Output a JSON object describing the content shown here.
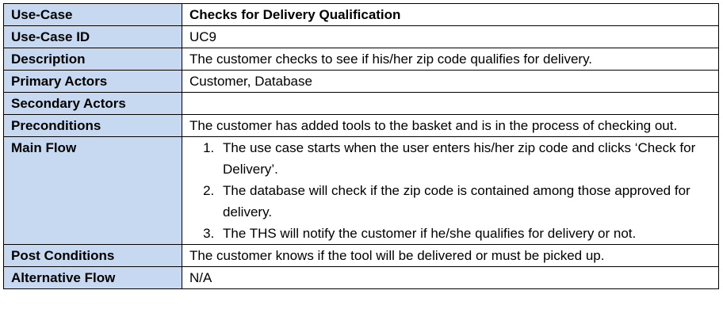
{
  "rows": [
    {
      "label": "Use-Case",
      "value": "Checks for Delivery Qualification"
    },
    {
      "label": "Use-Case ID",
      "value": "UC9"
    },
    {
      "label": "Description",
      "value": "The customer checks to see if his/her zip code qualifies for delivery."
    },
    {
      "label": "Primary Actors",
      "value": "Customer, Database"
    },
    {
      "label": "Secondary Actors",
      "value": ""
    },
    {
      "label": "Preconditions",
      "value": "The customer has added tools to the basket and is in the process of checking out."
    },
    {
      "label": "Main Flow",
      "steps": [
        "The use case starts when the user enters his/her zip code and clicks ‘Check for Delivery’.",
        "The database will check if the zip code is contained among those approved for delivery.",
        "The THS will notify the customer if he/she qualifies for delivery or not."
      ]
    },
    {
      "label": "Post Conditions",
      "value": "The customer knows if the tool will be delivered or must be picked up."
    },
    {
      "label": "Alternative Flow",
      "value": "N/A"
    }
  ]
}
